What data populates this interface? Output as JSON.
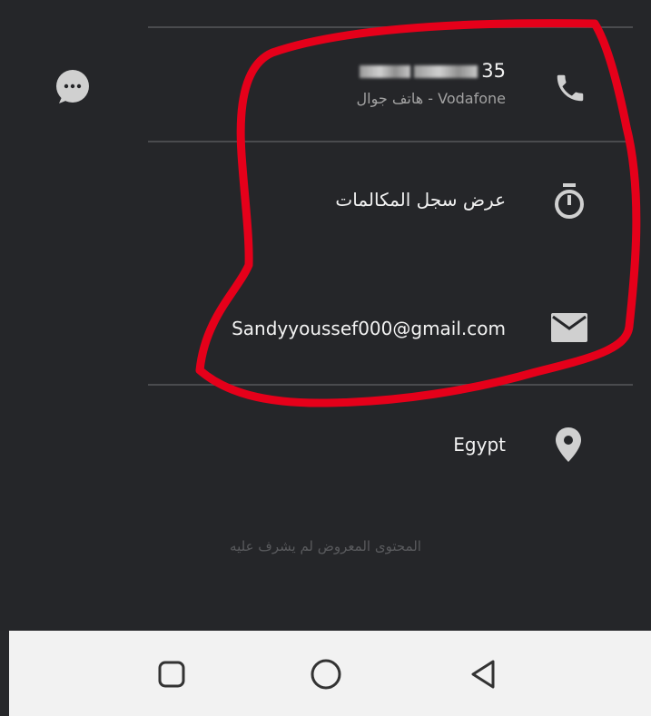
{
  "contact": {
    "phone": {
      "number_visible_suffix": "35",
      "type_label": "هاتف جوال - Vodafone"
    },
    "call_history": {
      "label": "عرض سجل المكالمات"
    },
    "email": {
      "value": "Sandyyoussef000@gmail.com"
    },
    "address": {
      "value": "Egypt"
    }
  },
  "footer": {
    "disclaimer": "المحتوى المعروض لم يشرف عليه"
  },
  "icons": {
    "phone": "phone-icon",
    "message": "message-icon",
    "call_history": "stopwatch-icon",
    "email": "email-icon",
    "address": "location-pin-icon",
    "nav_recent": "square-icon",
    "nav_home": "circle-icon",
    "nav_back": "triangle-back-icon"
  },
  "colors": {
    "background": "#252629",
    "text_primary": "#f2f2f2",
    "text_secondary": "#a2a2a2",
    "icon": "#d0d0d0",
    "annotation": "#e5001a",
    "navbar": "#f2f2f2"
  }
}
